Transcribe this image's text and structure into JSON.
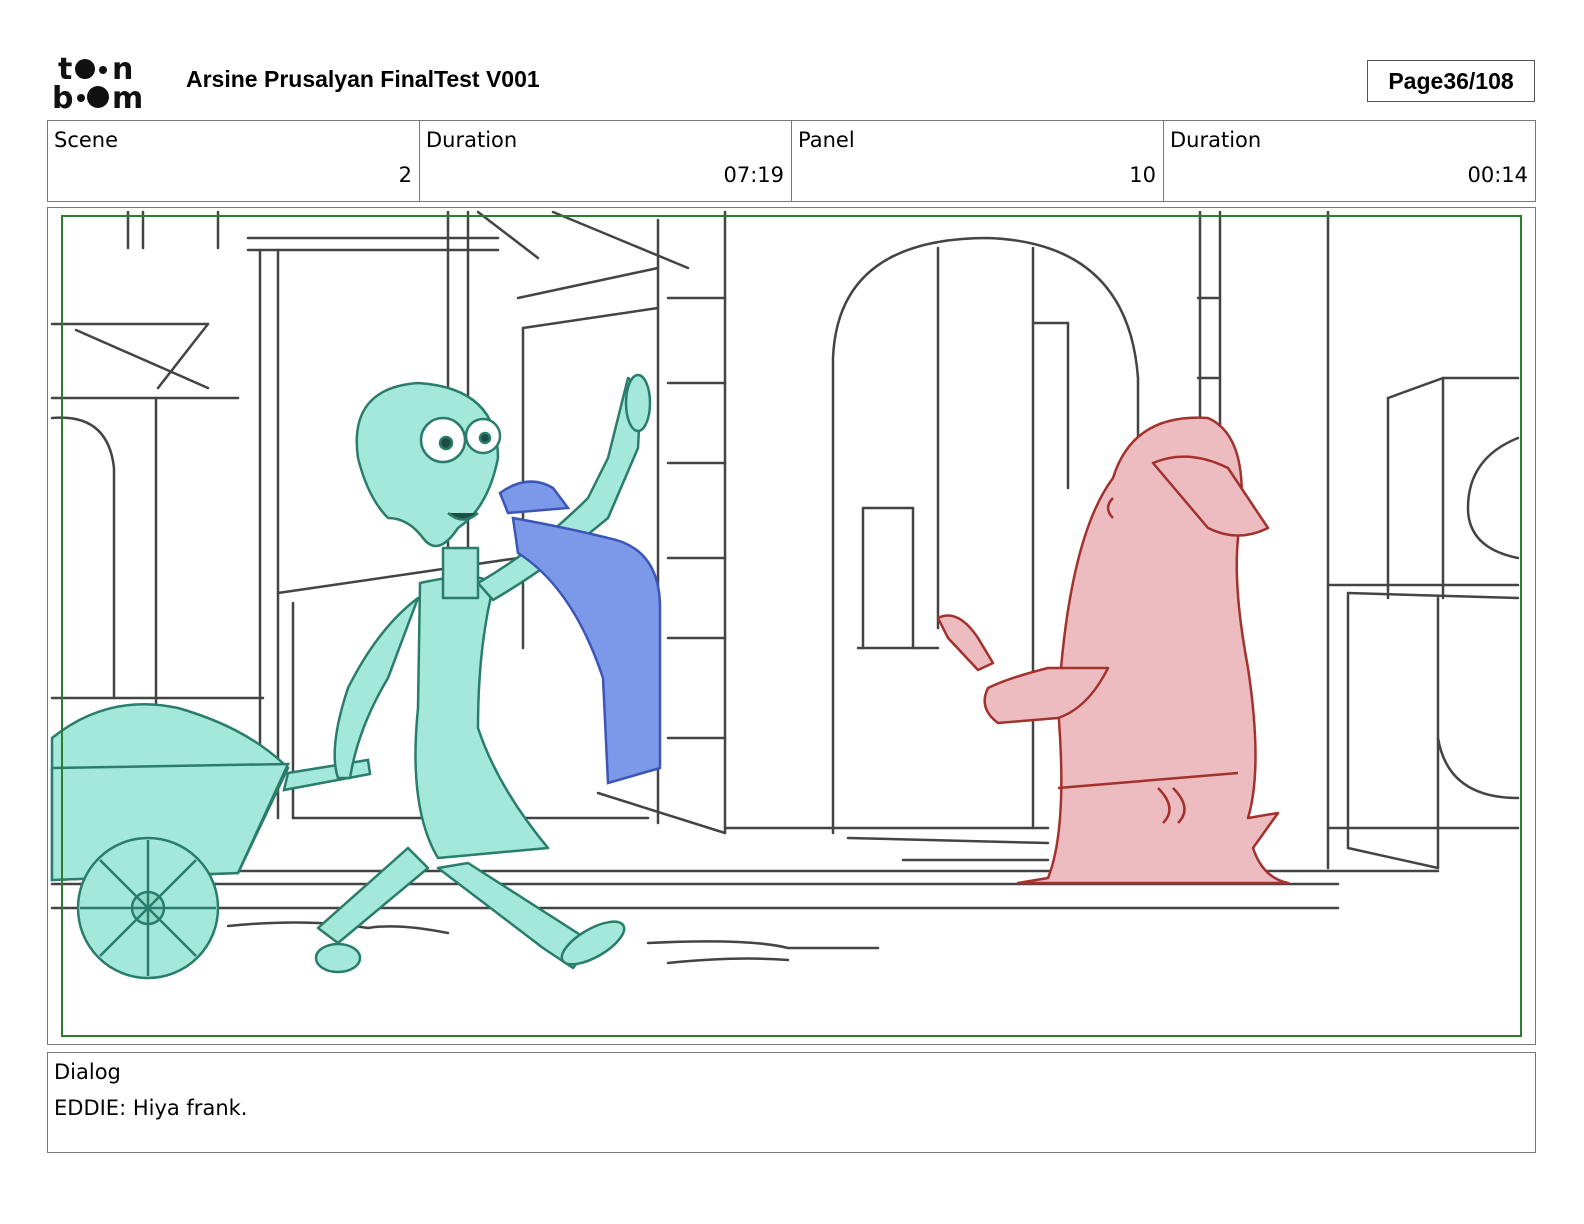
{
  "header": {
    "logo_name": "toonboom-logo",
    "title": "Arsine Prusalyan FinalTest V001",
    "page_label": "Page",
    "page_value": "36/108"
  },
  "info": {
    "scene_label": "Scene",
    "scene_value": "2",
    "scene_duration_label": "Duration",
    "scene_duration_value": "07:19",
    "panel_label": "Panel",
    "panel_value": "10",
    "panel_duration_label": "Duration",
    "panel_duration_value": "00:14"
  },
  "panel": {
    "safe_frame_color": "#2e7d2e",
    "characters": [
      {
        "name": "Eddie",
        "color": "#9fe6d6"
      },
      {
        "name": "blue-figure",
        "color": "#7b99e8"
      },
      {
        "name": "Frank",
        "color": "#e9b8bd"
      }
    ]
  },
  "dialog": {
    "label": "Dialog",
    "text": "EDDIE: Hiya frank."
  }
}
